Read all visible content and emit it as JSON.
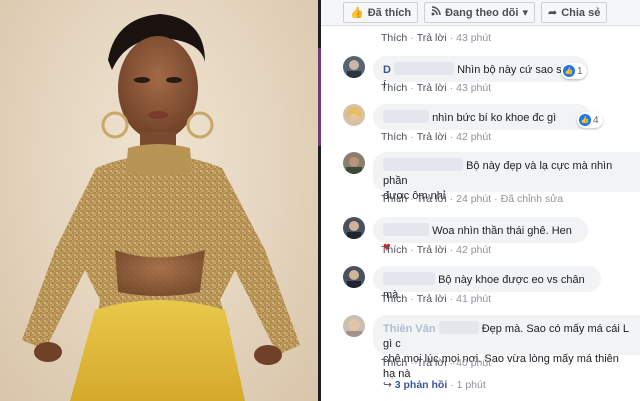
{
  "colors": {
    "link": "#385898",
    "meta": "#90949c",
    "bubble": "#f2f3f5",
    "like": "#1877f2",
    "heart": "#e4212a"
  },
  "photo": {
    "description_icon": "portrait-photo"
  },
  "action_bar": {
    "like": {
      "icon": "thumbs-up-icon",
      "label": "Đã thích"
    },
    "follow": {
      "icon": "rss-icon",
      "label": "Đang theo dõi"
    },
    "share": {
      "icon": "share-arrow-icon",
      "label": "Chia sẻ"
    }
  },
  "link_labels": {
    "like": "Thích",
    "reply": "Trả lời",
    "edited": "Đã chỉnh sửa"
  },
  "comments": [
    {
      "text": "",
      "time": "43 phút"
    },
    {
      "initial": "D",
      "text": "Nhìn bộ này cứ sao sao í",
      "reaction_count": "1",
      "time": "43 phút"
    },
    {
      "text": "nhìn bức bí ko khoe đc gì",
      "reaction_count": "4",
      "time": "42 phút"
    },
    {
      "text_line1": "Bộ này đẹp và lạ cực mà nhìn phần",
      "text_line2": "được ôm nhỉ",
      "time": "24 phút",
      "edited": true
    },
    {
      "text": "Woa nhìn thần thái ghê. Hen",
      "emoji": "♥",
      "time": "42 phút"
    },
    {
      "text": "Bộ này khoe được eo vs chân mà.",
      "time": "41 phút"
    },
    {
      "prefix_line1": "Thiên Vân",
      "text_line1": "Đẹp mà. Sao có mấy má cái L gì c",
      "text_line2": "chê mọi lúc mọi nơi. Sao vừa lòng mấy má thiên hạ nà",
      "time": "40 phút"
    }
  ],
  "replies_link": {
    "icon": "reply-arrow-icon",
    "label": "3 phản hồi",
    "time": "1 phút"
  }
}
